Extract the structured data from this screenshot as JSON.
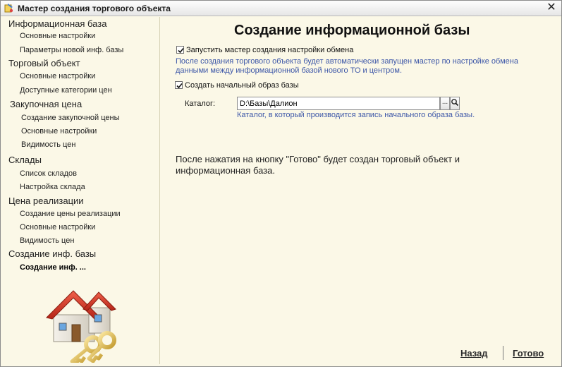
{
  "window": {
    "title": "Мастер создания торгового объекта",
    "close_label": "✕"
  },
  "nav": {
    "sections": [
      {
        "label": "Информационная база",
        "items": [
          "Основные настройки",
          "Параметры новой инф. базы"
        ]
      },
      {
        "label": "Торговый объект",
        "items": [
          "Основные настройки",
          "Доступные категории цен"
        ]
      },
      {
        "label": "Закупочная цена",
        "items": [
          "Создание закупочной цены",
          "Основные настройки",
          "Видимость цен"
        ]
      },
      {
        "label": "Склады",
        "items": [
          "Список складов",
          "Настройка склада"
        ]
      },
      {
        "label": "Цена реализации",
        "items": [
          "Создание цены реализации",
          "Основные настройки",
          "Видимость цен"
        ]
      },
      {
        "label": "Создание инф. базы",
        "items": [
          "Создание инф. ..."
        ]
      }
    ],
    "current_item": "Создание инф. ..."
  },
  "main": {
    "title": "Создание информационной базы",
    "run_exchange_wizard": {
      "label": "Запустить мастер создания настройки обмена",
      "checked": true,
      "hint_line1": "После создания торгового объекта будет автоматически запущен мастер по настройке обмена",
      "hint_line2": "данными между информационной базой нового ТО и центром."
    },
    "create_initial_image": {
      "label": "Создать начальный образ базы",
      "checked": true
    },
    "catalog": {
      "label": "Каталог:",
      "value": "D:\\Базы\\Далион",
      "browse_label": "...",
      "search_icon": "magnifier-icon",
      "hint": "Каталог, в который производится запись начального образа базы."
    },
    "final_note_line1": "После нажатия на кнопку \"Готово\" будет создан торговый объект и",
    "final_note_line2": "информационная база."
  },
  "footer": {
    "back_label": "Назад",
    "finish_label": "Готово"
  }
}
